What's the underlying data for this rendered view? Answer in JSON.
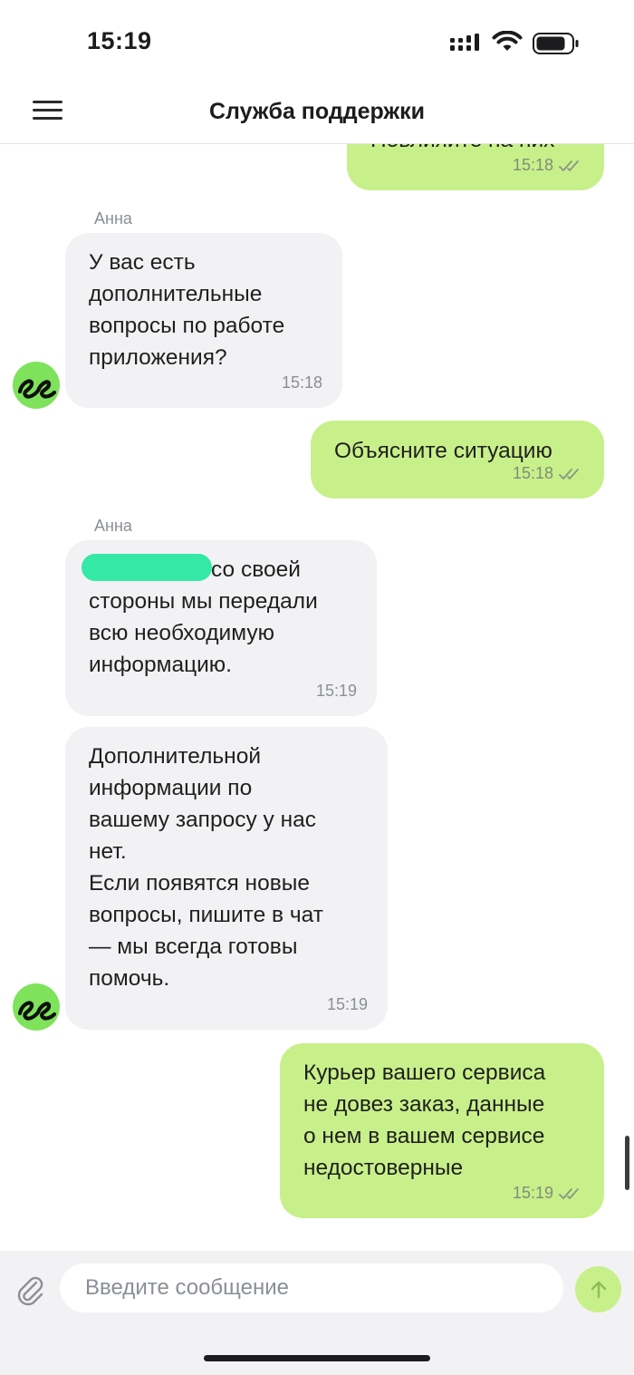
{
  "status_bar": {
    "time": "15:19"
  },
  "header": {
    "title": "Служба поддержки"
  },
  "chat": {
    "messages": [
      {
        "direction": "outgoing",
        "text": "Повлияйте на них",
        "time": "15:18",
        "status": "read"
      },
      {
        "direction": "incoming",
        "sender": "Анна",
        "text": "У вас есть\nдополнительные\nвопросы по работе\nприложения?",
        "time": "15:18"
      },
      {
        "direction": "outgoing",
        "text": "Объясните ситуацию",
        "time": "15:18",
        "status": "read"
      },
      {
        "direction": "incoming",
        "sender": "Анна",
        "text": "со своей\nстороны мы передали\nвсю необходимую\nинформацию.",
        "time": "15:19",
        "redacted_prefix": true
      },
      {
        "direction": "incoming",
        "text": "Дополнительной\nинформации по\nвашему запросу у нас\nнет.\nЕсли появятся новые\nвопросы, пишите в чат\n— мы всегда готовы\nпомочь.",
        "time": "15:19"
      },
      {
        "direction": "outgoing",
        "text": "Курьер вашего сервиса\nне довез заказ, данные\nо нем в вашем сервисе\nнедостоверные",
        "time": "15:19",
        "status": "read"
      }
    ]
  },
  "input": {
    "placeholder": "Введите сообщение",
    "value": ""
  },
  "icons": {
    "menu": "hamburger-menu-icon",
    "attach": "paperclip-icon",
    "send": "arrow-up-icon",
    "read_status": "double-check-icon",
    "avatar": "brand-logo-icon"
  },
  "colors": {
    "outgoing_bubble": "#c8f08a",
    "incoming_bubble": "#f2f2f4",
    "avatar": "#7ee35a",
    "redaction": "#34e9a6"
  }
}
